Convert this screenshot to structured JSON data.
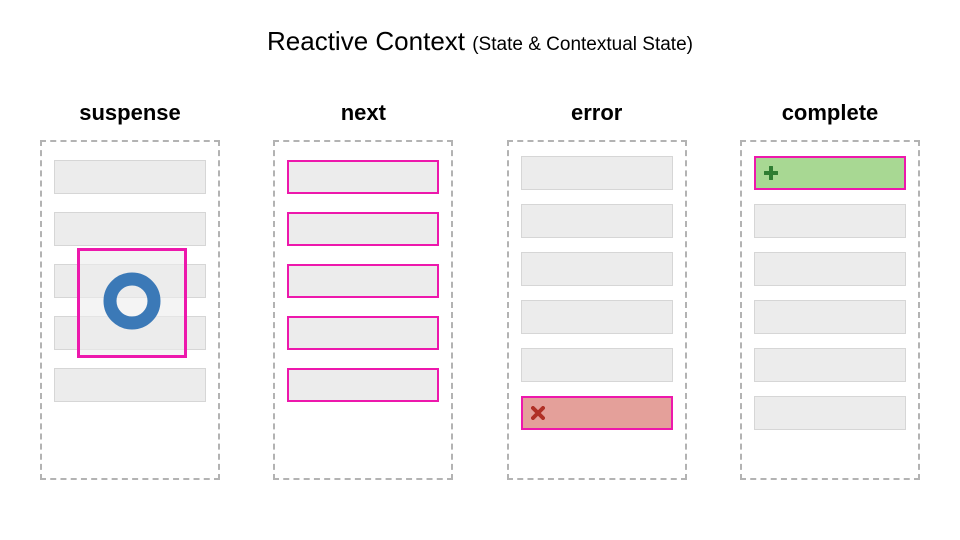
{
  "title": {
    "main": "Reactive Context",
    "sub": "(State & Contextual State)"
  },
  "columns": [
    {
      "key": "suspense",
      "label": "suspense",
      "rowCount": 5,
      "rowStyle": "plain",
      "overlay": {
        "type": "spinner",
        "icon": "spinner-icon",
        "color": "#3b79b7"
      }
    },
    {
      "key": "next",
      "label": "next",
      "rowCount": 5,
      "rowStyle": "magenta"
    },
    {
      "key": "error",
      "label": "error",
      "rowCount": 5,
      "rowStyle": "plain",
      "trailing": {
        "style": "error",
        "icon": "x-icon",
        "color": "#b03026"
      }
    },
    {
      "key": "complete",
      "label": "complete",
      "rowCount": 5,
      "rowStyle": "plain",
      "leading": {
        "style": "complete",
        "icon": "plus-icon",
        "color": "#2f7d32"
      }
    }
  ]
}
